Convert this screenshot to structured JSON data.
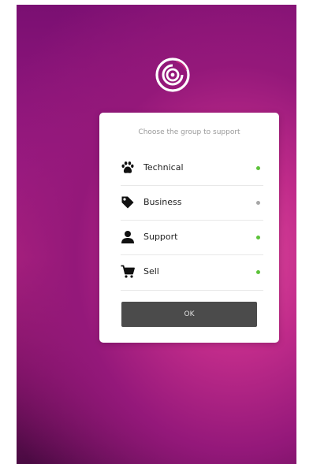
{
  "colors": {
    "online": "#5cc23a",
    "offline": "#a7a7a7",
    "button": "#4b4b4b"
  },
  "logo": {
    "icon": "concentric-circles-logo-icon"
  },
  "dialog": {
    "title": "Choose the group to support",
    "groups": [
      {
        "label": "Technical",
        "icon": "paw-icon",
        "status": "online"
      },
      {
        "label": "Business",
        "icon": "tag-icon",
        "status": "offline"
      },
      {
        "label": "Support",
        "icon": "user-icon",
        "status": "online"
      },
      {
        "label": "Sell",
        "icon": "shopping-cart-icon",
        "status": "online"
      }
    ],
    "ok_label": "OK"
  }
}
